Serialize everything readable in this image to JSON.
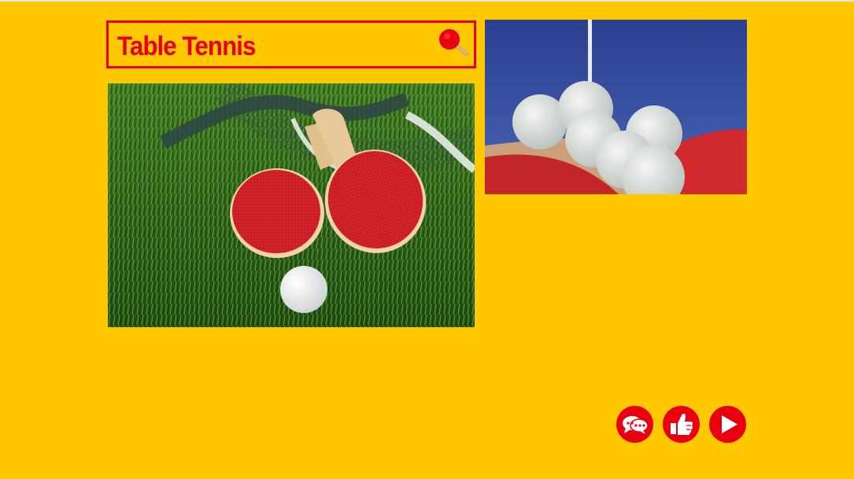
{
  "header": {
    "title": "Table Tennis",
    "logo_icon": "ping-pong-paddle-icon"
  },
  "images": {
    "main": "paddles-on-grass-photo",
    "secondary": "ping-pong-balls-photo"
  },
  "actions": [
    {
      "icon": "comments-icon"
    },
    {
      "icon": "thumbs-up-icon"
    },
    {
      "icon": "play-icon"
    }
  ],
  "colors": {
    "background": "#ffc800",
    "accent": "#e8000f",
    "icon_fg": "#ffffff"
  }
}
